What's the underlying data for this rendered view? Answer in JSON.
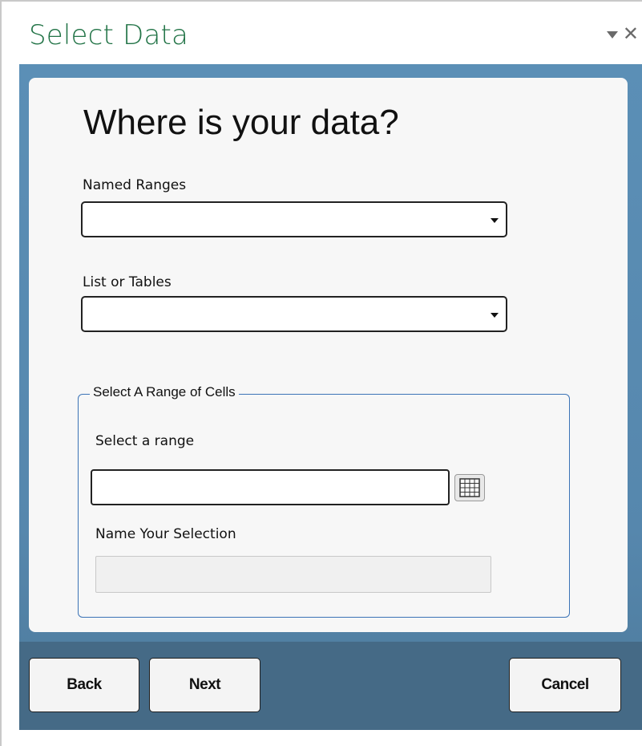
{
  "pane": {
    "title": "Select Data",
    "menu_icon": "dropdown-arrow-icon",
    "close_glyph": "✕"
  },
  "main": {
    "heading": "Where is your data?",
    "named_ranges": {
      "label": "Named Ranges",
      "value": ""
    },
    "lists_or_tables": {
      "label": "List or Tables",
      "value": ""
    },
    "range_group": {
      "legend": "Select A Range of Cells",
      "select_range_label": "Select a range",
      "range_value": "",
      "range_picker_icon": "grid-icon",
      "name_selection_label": "Name Your Selection",
      "name_value": ""
    }
  },
  "footer": {
    "back_label": "Back",
    "next_label": "Next",
    "cancel_label": "Cancel"
  },
  "colors": {
    "title_green": "#217346",
    "frame_blue": "#5b8fb6",
    "footer_blue": "#456a86",
    "group_border": "#3b73b6"
  }
}
